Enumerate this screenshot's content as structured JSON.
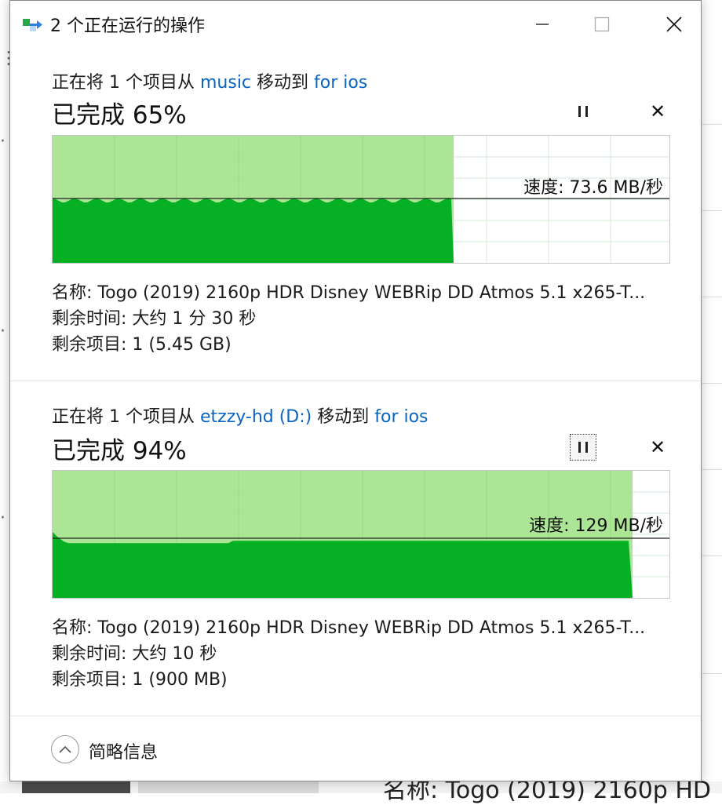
{
  "window": {
    "title": "2 个正在运行的操作",
    "icon": "file-move-icon"
  },
  "operations": [
    {
      "desc_prefix": "正在将 1 个项目从 ",
      "source": "music",
      "desc_mid": " 移动到 ",
      "destination": "for ios",
      "percent_text": "已完成 65%",
      "progress": 0.65,
      "speed_text": "速度: 73.6 MB/秒",
      "name_text": "名称: Togo (2019) 2160p HDR Disney WEBRip DD Atmos 5.1 x265-T...",
      "time_text": "剩余时间: 大约 1 分 30 秒",
      "items_text": "剩余项目: 1 (5.45 GB)"
    },
    {
      "desc_prefix": "正在将 1 个项目从 ",
      "source": "etzzy-hd (D:)",
      "desc_mid": " 移动到 ",
      "destination": "for ios",
      "percent_text": "已完成 94%",
      "progress": 0.94,
      "speed_text": "速度: 129 MB/秒",
      "name_text": "名称: Togo (2019) 2160p HDR Disney WEBRip DD Atmos 5.1 x265-T...",
      "time_text": "剩余时间: 大约 10 秒",
      "items_text": "剩余项目: 1 (900 MB)"
    }
  ],
  "footer": {
    "toggle_label": "简略信息"
  },
  "background": {
    "bottom_text": "名称: Togo (2019) 2160p HD"
  },
  "colors": {
    "link": "#0a64c2",
    "graph_done": "#a8e48f",
    "graph_speed": "#06b025",
    "grid": "#d3ead6"
  }
}
